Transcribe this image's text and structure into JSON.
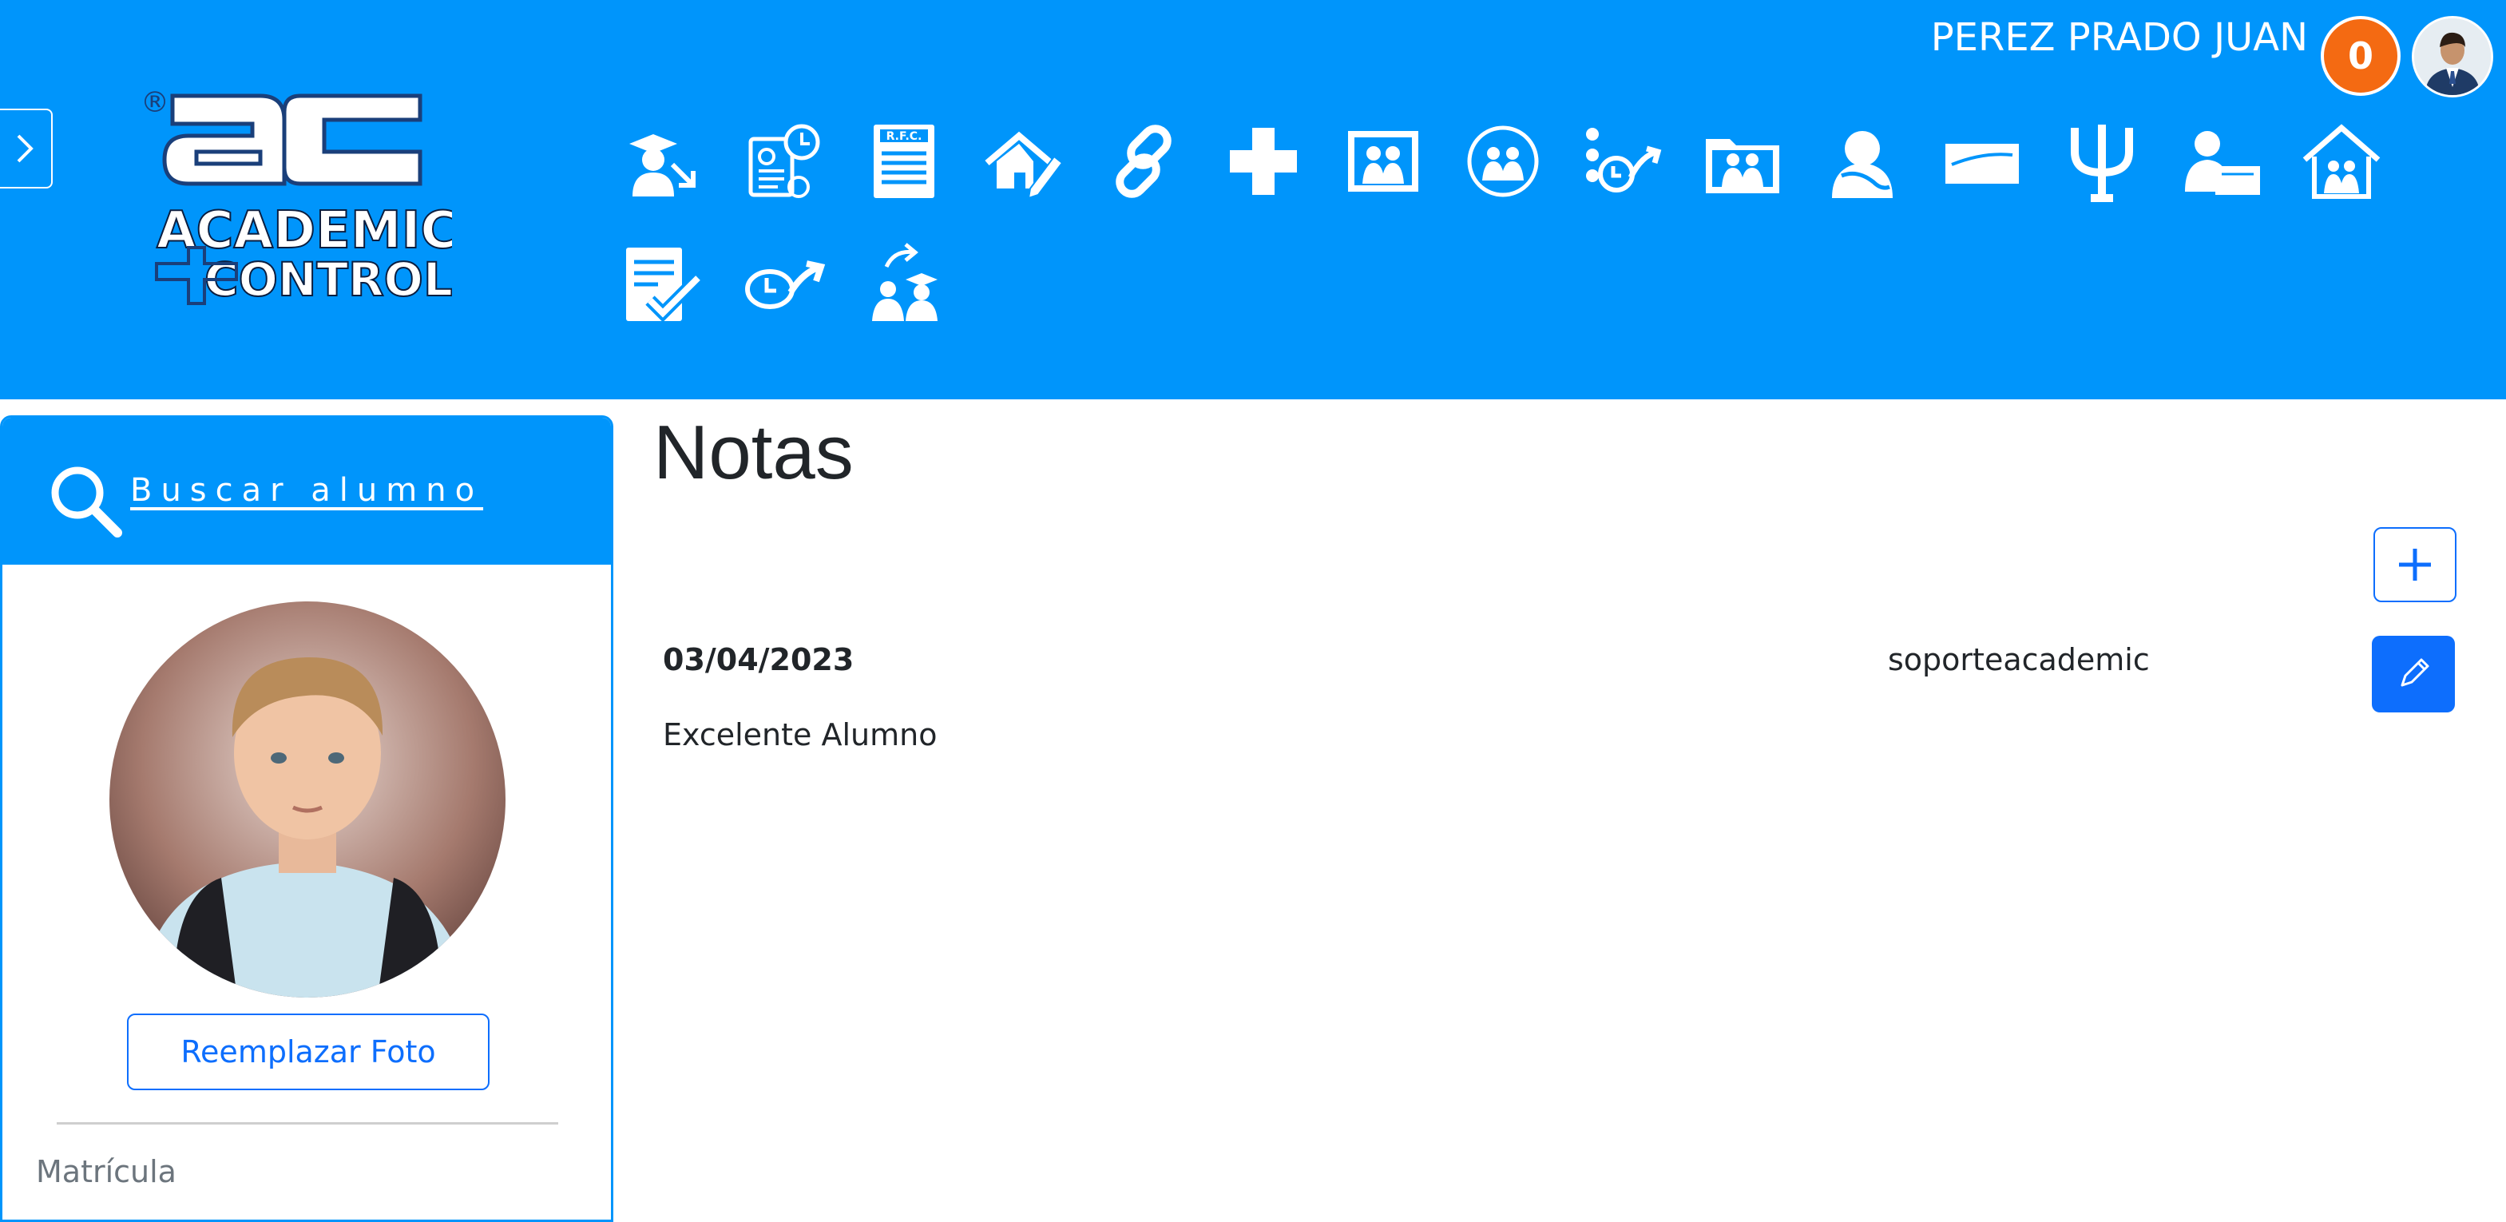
{
  "header": {
    "logo_text_top": "ac",
    "logo_text_line1": "ACADEMIC",
    "logo_text_line2": "CONTROL",
    "logo_registered": "®",
    "user_name": "PEREZ PRADO JUAN",
    "notification_count": "0",
    "accent_color": "#0095fb",
    "badge_color": "#f46a12"
  },
  "toolbar": {
    "icons": [
      "graduate-exit-icon",
      "document-clock-icon",
      "rfc-document-icon",
      "house-edit-icon",
      "link-icon",
      "medical-cross-icon",
      "family-photo-icon",
      "group-circle-icon",
      "behavior-clock-icon",
      "folder-family-icon",
      "tutor-icon",
      "card-icon",
      "psychology-icon",
      "teacher-desk-icon",
      "home-family-icon",
      "checklist-icon",
      "clock-arrow-icon",
      "students-return-icon"
    ],
    "rfc_label": "R.F.C."
  },
  "sidebar": {
    "search_label": "Buscar alumno",
    "replace_photo_label": "Reemplazar Foto",
    "matricula_label": "Matrícula"
  },
  "main": {
    "title": "Notas",
    "notes": [
      {
        "date": "03/04/2023",
        "author": "soporteacademic",
        "text": "Excelente Alumno"
      }
    ]
  }
}
